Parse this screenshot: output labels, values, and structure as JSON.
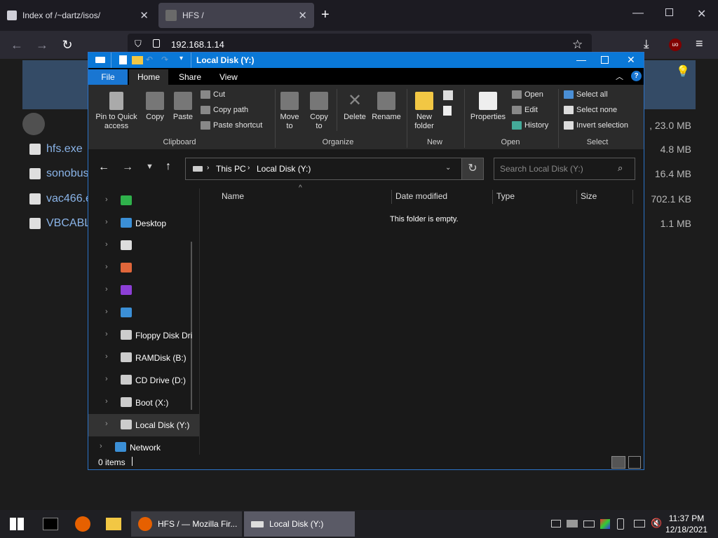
{
  "browser": {
    "tabs": [
      {
        "label": "Index of /~dartz/isos/"
      },
      {
        "label": "HFS /"
      }
    ],
    "url": "192.168.1.14"
  },
  "hfs": {
    "rows": [
      {
        "name": "",
        "size": ", 23.0 MB"
      },
      {
        "name": "hfs.exe",
        "size": "4.8 MB"
      },
      {
        "name": "sonobus",
        "size": "16.4 MB"
      },
      {
        "name": "vac466.e",
        "size": "702.1 KB"
      },
      {
        "name": "VBCABLI",
        "size": "1.1 MB"
      }
    ]
  },
  "explorer": {
    "title": "Local Disk (Y:)",
    "menu": [
      "File",
      "Home",
      "Share",
      "View"
    ],
    "ribbon": {
      "pin": "Pin to Quick access",
      "copy": "Copy",
      "paste": "Paste",
      "cut": "Cut",
      "copy_path": "Copy path",
      "paste_shortcut": "Paste shortcut",
      "move_to": "Move to",
      "copy_to": "Copy to",
      "delete": "Delete",
      "rename": "Rename",
      "new_folder": "New folder",
      "properties": "Properties",
      "open": "Open",
      "edit": "Edit",
      "history": "History",
      "select_all": "Select all",
      "select_none": "Select none",
      "invert_selection": "Invert selection",
      "groups": [
        "Clipboard",
        "Organize",
        "New",
        "Open",
        "Select"
      ]
    },
    "breadcrumb": [
      "This PC",
      "Local Disk (Y:)"
    ],
    "search_placeholder": "Search Local Disk (Y:)",
    "nav_items": [
      "",
      "Desktop",
      "",
      "",
      "",
      "",
      "Floppy Disk Dri",
      "RAMDisk (B:)",
      "CD Drive (D:)",
      "Boot (X:)",
      "Local Disk (Y:)",
      "Network"
    ],
    "columns": [
      "Name",
      "Date modified",
      "Type",
      "Size"
    ],
    "empty_text": "This folder is empty.",
    "status": "0 items"
  },
  "taskbar": {
    "windows": [
      "HFS / — Mozilla Fir...",
      "Local Disk (Y:)"
    ],
    "time": "11:37 PM",
    "date": "12/18/2021"
  },
  "colors": {
    "accent": "#0a78d7",
    "ribbon": "#2b2b2b",
    "hfs_header": "#344b66"
  }
}
